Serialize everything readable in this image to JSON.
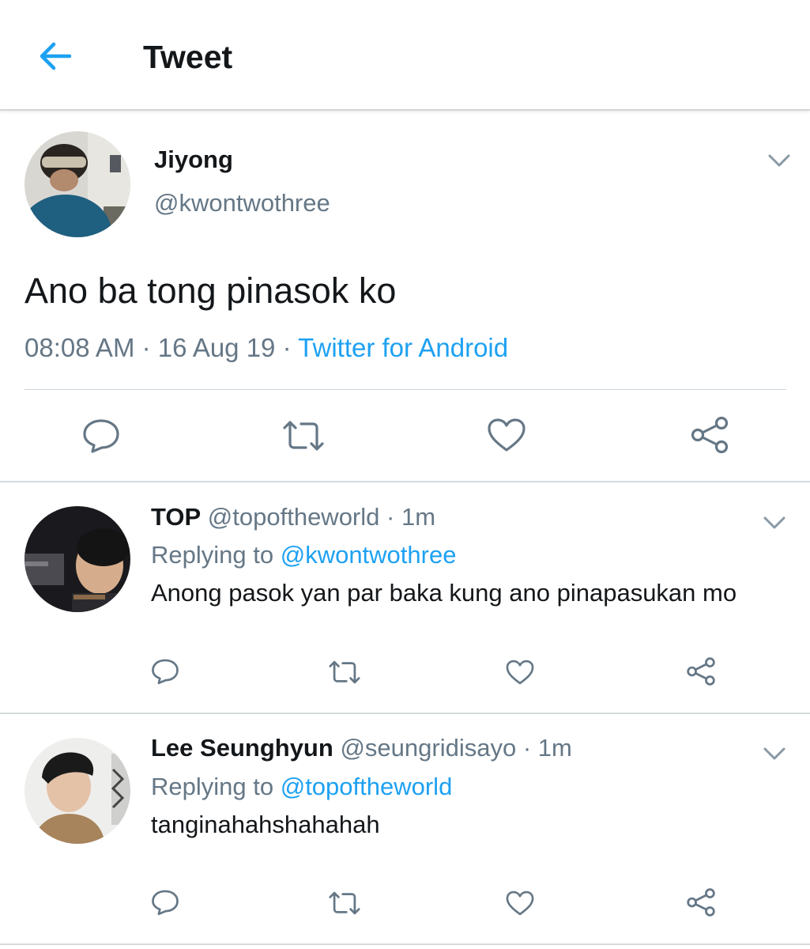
{
  "header": {
    "title": "Tweet"
  },
  "main_tweet": {
    "display_name": "Jiyong",
    "handle": "@kwontwothree",
    "text": "Ano ba tong pinasok ko",
    "time": "08:08 AM",
    "date": "16 Aug 19",
    "separator": " · ",
    "source": "Twitter for Android"
  },
  "replies": [
    {
      "display_name": "TOP",
      "handle": "@topoftheworld",
      "time_ago": "1m",
      "replying_label": "Replying to",
      "replying_to": "@kwontwothree",
      "text": "Anong pasok yan par baka kung ano pinapasukan mo"
    },
    {
      "display_name": "Lee Seunghyun",
      "handle": "@seungridisayo",
      "time_ago": "1m",
      "replying_label": "Replying to",
      "replying_to": "@topoftheworld",
      "text": "tanginahahshahahah"
    }
  ],
  "icons": {
    "back": "arrow-left-icon",
    "reply": "speech-bubble-icon",
    "retweet": "retweet-icon",
    "like": "heart-icon",
    "share": "share-icon",
    "more": "chevron-down-icon"
  },
  "colors": {
    "accent": "#1da1f2",
    "text_primary": "#14171a",
    "text_secondary": "#657786",
    "icon_gray": "#657786",
    "divider": "#ccd6dd"
  }
}
